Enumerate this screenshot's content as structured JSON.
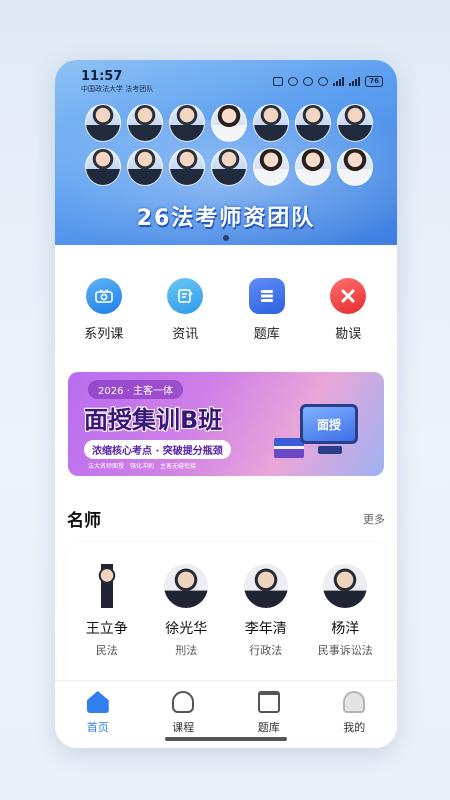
{
  "status_bar": {
    "time": "11:57",
    "school": "中国政法大学 法考团队",
    "battery": "76"
  },
  "banner": {
    "title": "26法考师资团队",
    "photo_count": 14
  },
  "quick_nav": [
    {
      "label": "系列课",
      "icon": "video-camera-icon"
    },
    {
      "label": "资讯",
      "icon": "notepad-pencil-icon"
    },
    {
      "label": "题库",
      "icon": "book-stack-icon"
    },
    {
      "label": "勘误",
      "icon": "close-x-icon"
    }
  ],
  "promo": {
    "tag": "2026 · 主客一体",
    "title": "面授集训B班",
    "subtitle": "浓缩核心考点 · 突破提分瓶颈",
    "features": [
      "法大名师面授",
      "强化冲刺",
      "主客无缝衔接"
    ],
    "monitor_text": "面授"
  },
  "teachers_section": {
    "title": "名师",
    "more": "更多",
    "teachers": [
      {
        "name": "王立争",
        "subject": "民法"
      },
      {
        "name": "徐光华",
        "subject": "刑法"
      },
      {
        "name": "李年清",
        "subject": "行政法"
      },
      {
        "name": "杨洋",
        "subject": "民事诉讼法"
      }
    ]
  },
  "tabbar": [
    {
      "label": "首页",
      "icon": "home-icon",
      "active": true
    },
    {
      "label": "课程",
      "icon": "course-icon",
      "active": false
    },
    {
      "label": "题库",
      "icon": "question-bank-icon",
      "active": false
    },
    {
      "label": "我的",
      "icon": "profile-icon",
      "active": false
    }
  ],
  "colors": {
    "accent": "#2f80ed",
    "banner_blue": "#5b9ef0",
    "promo_purple": "#b86df0",
    "error_red": "#e52e2e"
  }
}
